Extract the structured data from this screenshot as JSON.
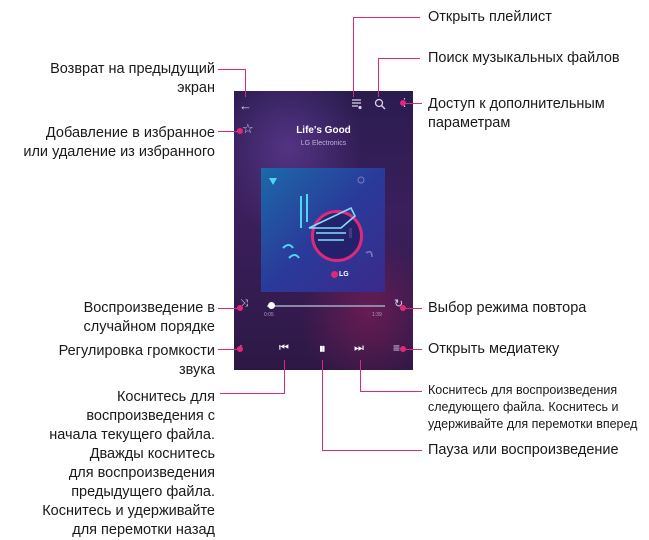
{
  "player": {
    "track_title": "Life's Good",
    "artist": "LG Electronics",
    "elapsed": "0:05",
    "duration": "1:39",
    "progress": 0.03,
    "album_logo": "LG",
    "icons": {
      "back": "arrow-left-icon",
      "playlist": "playlist-icon",
      "search": "search-icon",
      "more": "more-vertical-icon",
      "favorite": "star-icon",
      "shuffle": "shuffle-icon",
      "repeat": "repeat-icon",
      "volume": "volume-icon",
      "prev": "skip-previous-icon",
      "pause": "pause-icon",
      "next": "skip-next-icon",
      "library": "library-icon"
    }
  },
  "annotations": {
    "playlist": "Открыть плейлист",
    "search": "Поиск музыкальных файлов",
    "back_1": "Возврат на предыдущий",
    "back_2": "экран",
    "more_1": "Доступ к дополнительным",
    "more_2": "параметрам",
    "fav_1": "Добавление в избранное",
    "fav_2": "или удаление из избранного",
    "shuffle_1": "Воспроизведение в",
    "shuffle_2": "случайном порядке",
    "repeat": "Выбор режима повтора",
    "volume_1": "Регулировка громкости",
    "volume_2": "звука",
    "library": "Открыть медиатеку",
    "prev_1": "Коснитесь для",
    "prev_2": "воспроизведения с",
    "prev_3": "начала текущего файла.",
    "prev_4": "Дважды коснитесь",
    "prev_5": "для воспроизведения",
    "prev_6": "предыдущего файла.",
    "prev_7": "Коснитесь и удерживайте",
    "prev_8": "для перемотки назад",
    "next_1": "Коснитесь для воспроизведения",
    "next_2": "следующего файла. Коснитесь и",
    "next_3": "удерживайте для перемотки вперед",
    "pause": "Пауза или воспроизведение"
  },
  "colors": {
    "accent": "#e0287a",
    "screen_bg": "#2d1c50"
  }
}
